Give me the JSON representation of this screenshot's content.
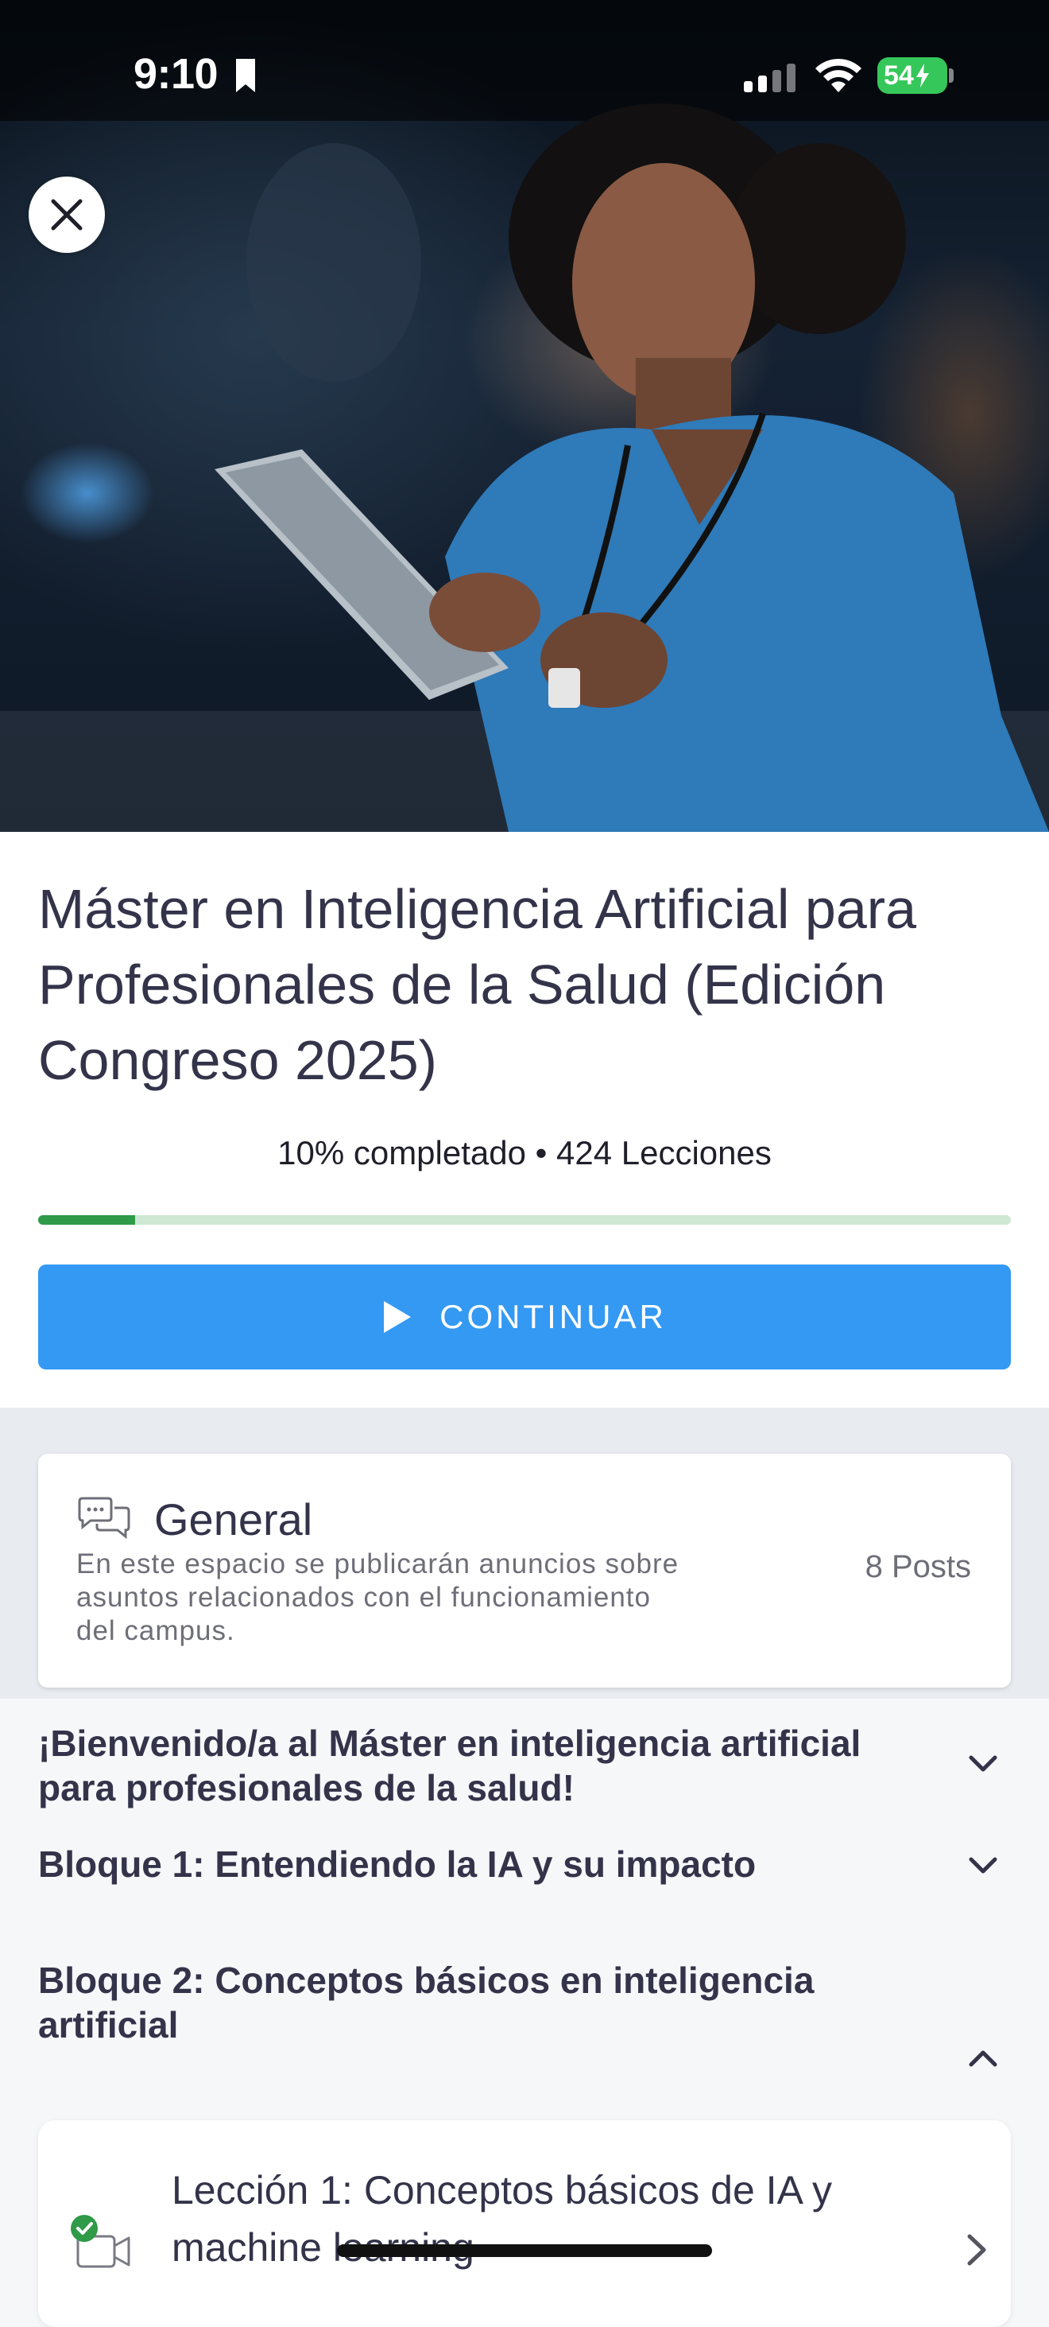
{
  "status_bar": {
    "time": "9:10",
    "battery": "54"
  },
  "course": {
    "title": "Máster en Inteligencia Artificial para Profesionales de la Salud (Edición Congreso 2025)",
    "progress_text": "10% completado • 424 Lecciones",
    "progress_fraction": 0.1,
    "continue_label": "CONTINUAR"
  },
  "forum": {
    "title": "General",
    "description": "En este espacio se publicarán anuncios sobre asuntos relacionados con el funcionamiento del campus.",
    "posts": "8 Posts"
  },
  "sections": [
    {
      "title": "¡Bienvenido/a al Máster en inteligencia artificial para profesionales de la salud!",
      "expanded": false
    },
    {
      "title": "Bloque 1: Entendiendo la IA y su impacto",
      "expanded": false
    },
    {
      "title": "Bloque 2: Conceptos básicos en inteligencia artificial",
      "expanded": true
    }
  ],
  "lessons": [
    {
      "title": "Lección 1: Conceptos básicos de IA y machine learning",
      "completed": true,
      "type": "video-icon"
    }
  ],
  "colors": {
    "accent": "#3399f3",
    "progress": "#2f9a47",
    "progress_track": "#cfe8d4",
    "text_dark": "#33334a",
    "completed": "#2f9a47"
  }
}
